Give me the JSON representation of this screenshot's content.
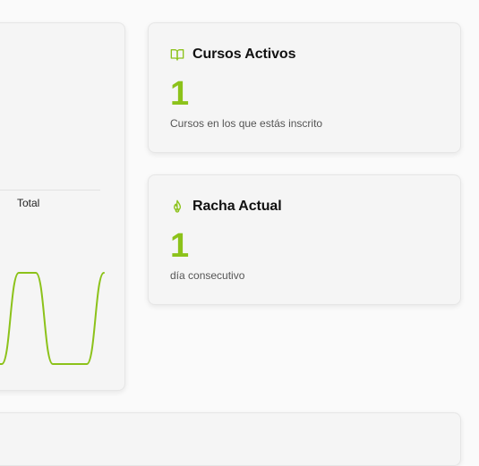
{
  "chart_data": {
    "type": "line",
    "series": [
      {
        "name": "Total",
        "values": [
          0,
          0,
          1,
          1,
          0,
          0,
          0,
          1
        ]
      }
    ],
    "legend": "Total",
    "color": "#8cc21a"
  },
  "stats": [
    {
      "title": "Cursos Activos",
      "value": "1",
      "description": "Cursos en los que estás inscrito",
      "icon": "book-open-icon"
    },
    {
      "title": "Racha Actual",
      "value": "1",
      "description": "día consecutivo",
      "icon": "flame-icon"
    }
  ],
  "colors": {
    "accent": "#8cc21a",
    "card_bg": "#f5f5f5",
    "page_bg": "#fafafa"
  }
}
